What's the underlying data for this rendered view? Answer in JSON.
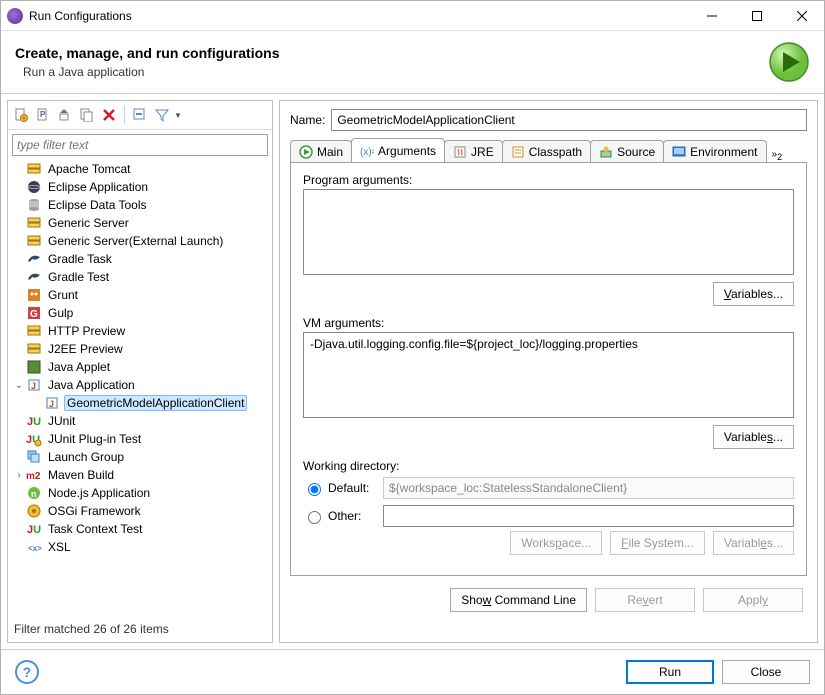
{
  "window": {
    "title": "Run Configurations"
  },
  "header": {
    "title": "Create, manage, and run configurations",
    "subtitle": "Run a Java application"
  },
  "filter": {
    "placeholder": "type filter text"
  },
  "tree": {
    "items": [
      {
        "label": "Apache Tomcat",
        "icon": "server",
        "expandable": false
      },
      {
        "label": "Eclipse Application",
        "icon": "eclipse",
        "expandable": false
      },
      {
        "label": "Eclipse Data Tools",
        "icon": "db",
        "expandable": false
      },
      {
        "label": "Generic Server",
        "icon": "server",
        "expandable": false
      },
      {
        "label": "Generic Server(External Launch)",
        "icon": "server",
        "expandable": false
      },
      {
        "label": "Gradle Task",
        "icon": "gradle",
        "expandable": false
      },
      {
        "label": "Gradle Test",
        "icon": "gradle",
        "expandable": false
      },
      {
        "label": "Grunt",
        "icon": "grunt",
        "expandable": false
      },
      {
        "label": "Gulp",
        "icon": "gulp",
        "expandable": false
      },
      {
        "label": "HTTP Preview",
        "icon": "server",
        "expandable": false
      },
      {
        "label": "J2EE Preview",
        "icon": "server",
        "expandable": false
      },
      {
        "label": "Java Applet",
        "icon": "applet",
        "expandable": false
      },
      {
        "label": "Java Application",
        "icon": "java",
        "expandable": true,
        "expanded": true
      },
      {
        "label": "GeometricModelApplicationClient",
        "icon": "java",
        "indent": 2,
        "selected": true
      },
      {
        "label": "JUnit",
        "icon": "junit",
        "expandable": false
      },
      {
        "label": "JUnit Plug-in Test",
        "icon": "junit-plug",
        "expandable": false
      },
      {
        "label": "Launch Group",
        "icon": "group",
        "expandable": false
      },
      {
        "label": "Maven Build",
        "icon": "m2",
        "expandable": true,
        "expanded": false
      },
      {
        "label": "Node.js Application",
        "icon": "node",
        "expandable": false
      },
      {
        "label": "OSGi Framework",
        "icon": "osgi",
        "expandable": false
      },
      {
        "label": "Task Context Test",
        "icon": "junit",
        "expandable": false
      },
      {
        "label": "XSL",
        "icon": "xsl",
        "expandable": false
      }
    ]
  },
  "status": "Filter matched 26 of 26 items",
  "form": {
    "name_label": "Name:",
    "name_value": "GeometricModelApplicationClient"
  },
  "tabs": {
    "items": [
      {
        "id": "main",
        "label": "Main"
      },
      {
        "id": "arguments",
        "label": "Arguments"
      },
      {
        "id": "jre",
        "label": "JRE"
      },
      {
        "id": "classpath",
        "label": "Classpath"
      },
      {
        "id": "source",
        "label": "Source"
      },
      {
        "id": "environment",
        "label": "Environment"
      }
    ],
    "overflow": "2",
    "active": "arguments"
  },
  "args": {
    "program_label": "Program arguments:",
    "program_value": "",
    "vm_label": "VM arguments:",
    "vm_value": "-Djava.util.logging.config.file=${project_loc}/logging.properties",
    "variables_btn": "Variables..."
  },
  "wd": {
    "title": "Working directory:",
    "default_label": "Default:",
    "default_value": "${workspace_loc:StatelessStandaloneClient}",
    "other_label": "Other:",
    "other_value": "",
    "workspace_btn": "Workspace...",
    "filesystem_btn": "File System...",
    "variables_btn": "Variables..."
  },
  "action_buttons": {
    "show_cmd": "Show Command Line",
    "revert": "Revert",
    "apply": "Apply"
  },
  "footer": {
    "run": "Run",
    "close": "Close"
  }
}
